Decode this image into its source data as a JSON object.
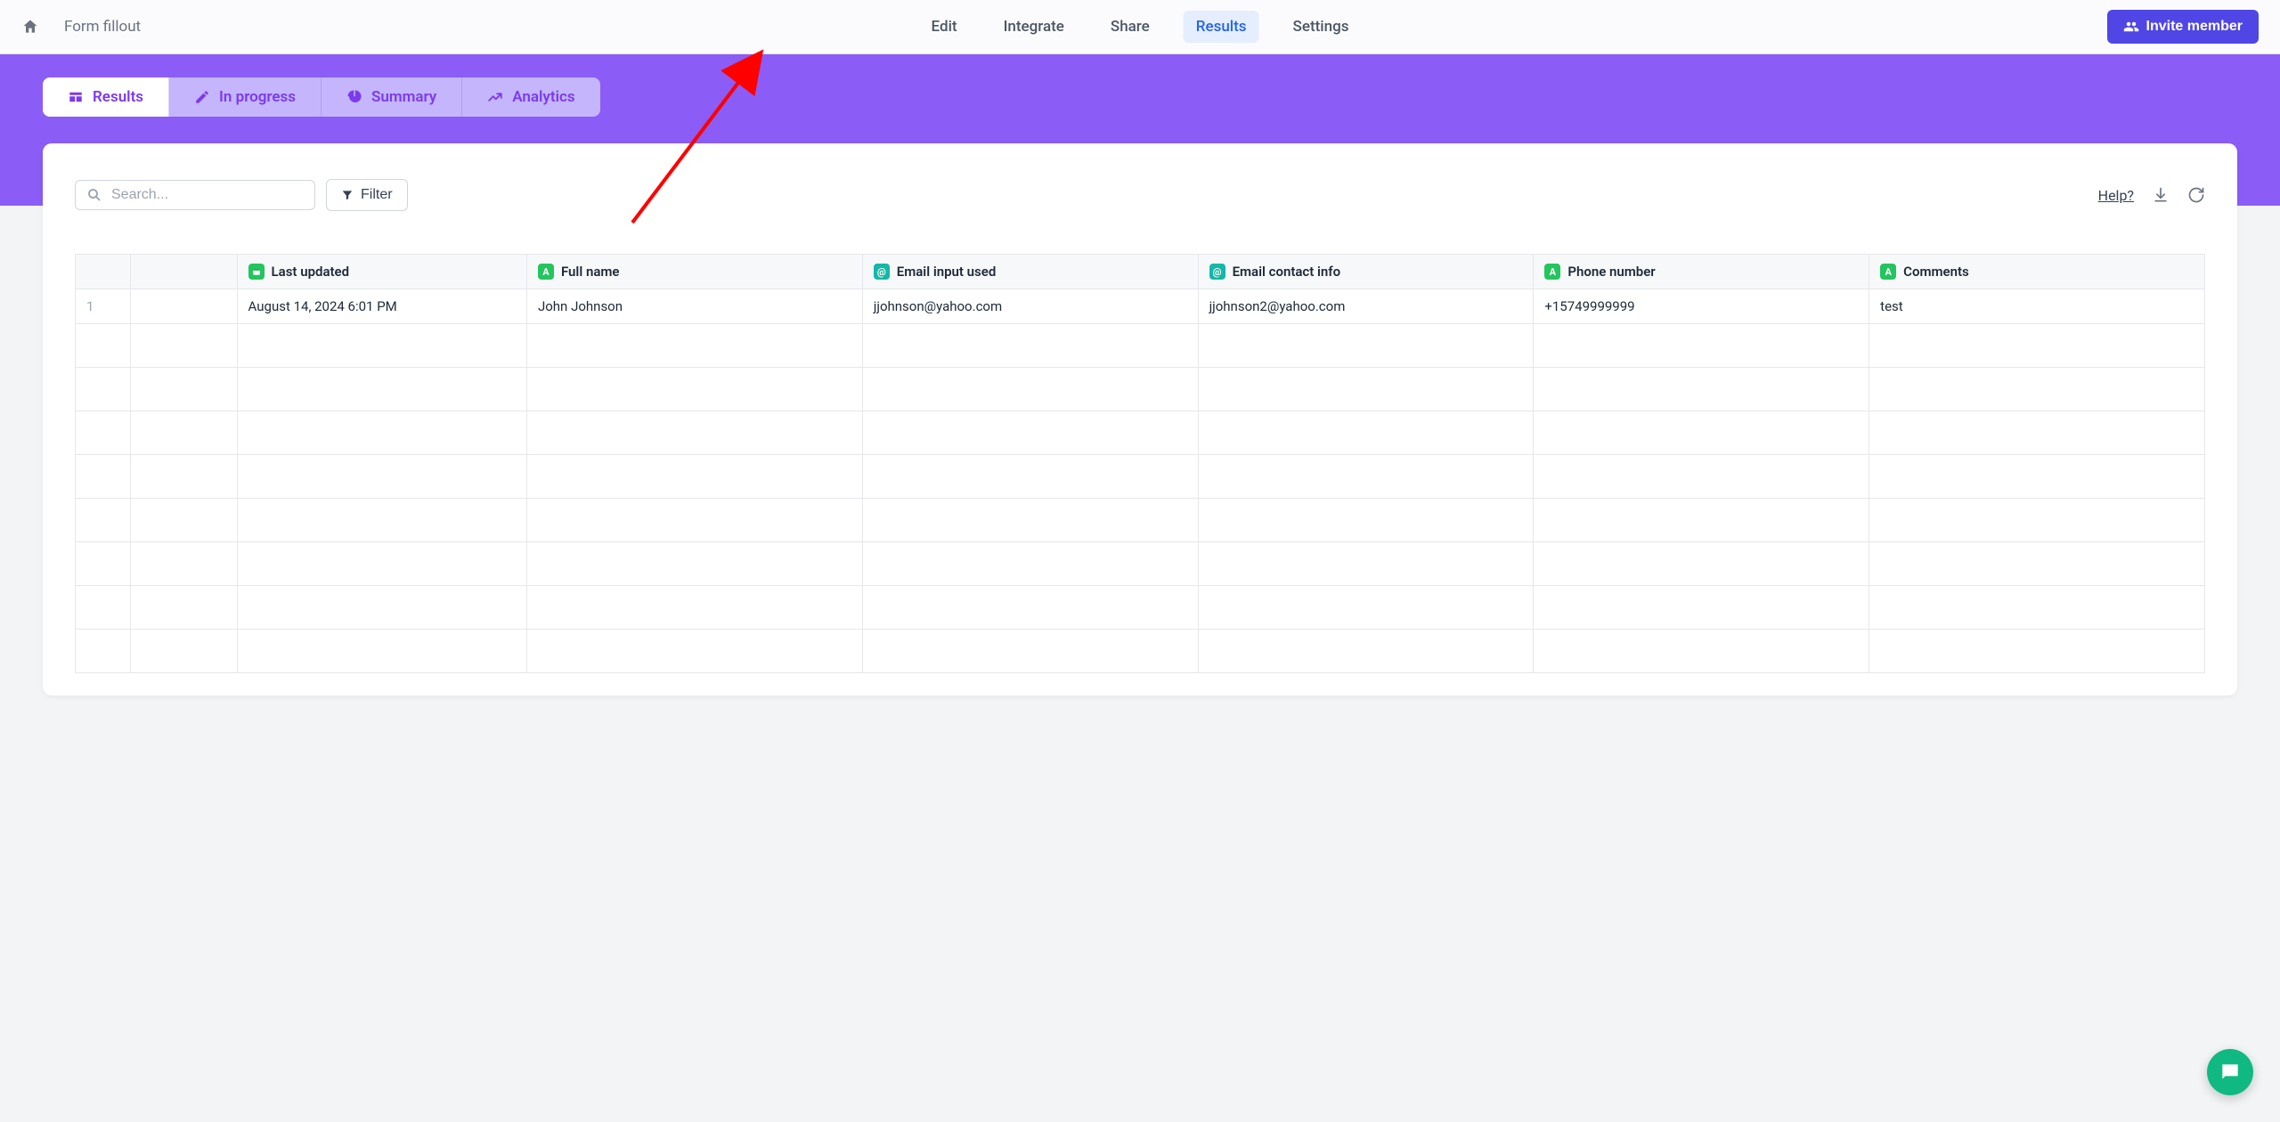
{
  "header": {
    "form_title": "Form fillout",
    "nav": {
      "edit": "Edit",
      "integrate": "Integrate",
      "share": "Share",
      "results": "Results",
      "settings": "Settings"
    },
    "invite_label": "Invite member"
  },
  "subtabs": {
    "results": "Results",
    "in_progress": "In progress",
    "summary": "Summary",
    "analytics": "Analytics"
  },
  "toolbar": {
    "search_placeholder": "Search...",
    "filter_label": "Filter",
    "help_label": "Help?"
  },
  "table": {
    "columns": {
      "last_updated": "Last updated",
      "full_name": "Full name",
      "email_input_used": "Email input used",
      "email_contact_info": "Email contact info",
      "phone_number": "Phone number",
      "comments": "Comments"
    },
    "rows": [
      {
        "idx": "1",
        "last_updated": "August 14, 2024 6:01 PM",
        "full_name": "John Johnson",
        "email_input_used": "jjohnson@yahoo.com",
        "email_contact_info": "jjohnson2@yahoo.com",
        "phone_number": "+15749999999",
        "comments": "test"
      }
    ]
  }
}
